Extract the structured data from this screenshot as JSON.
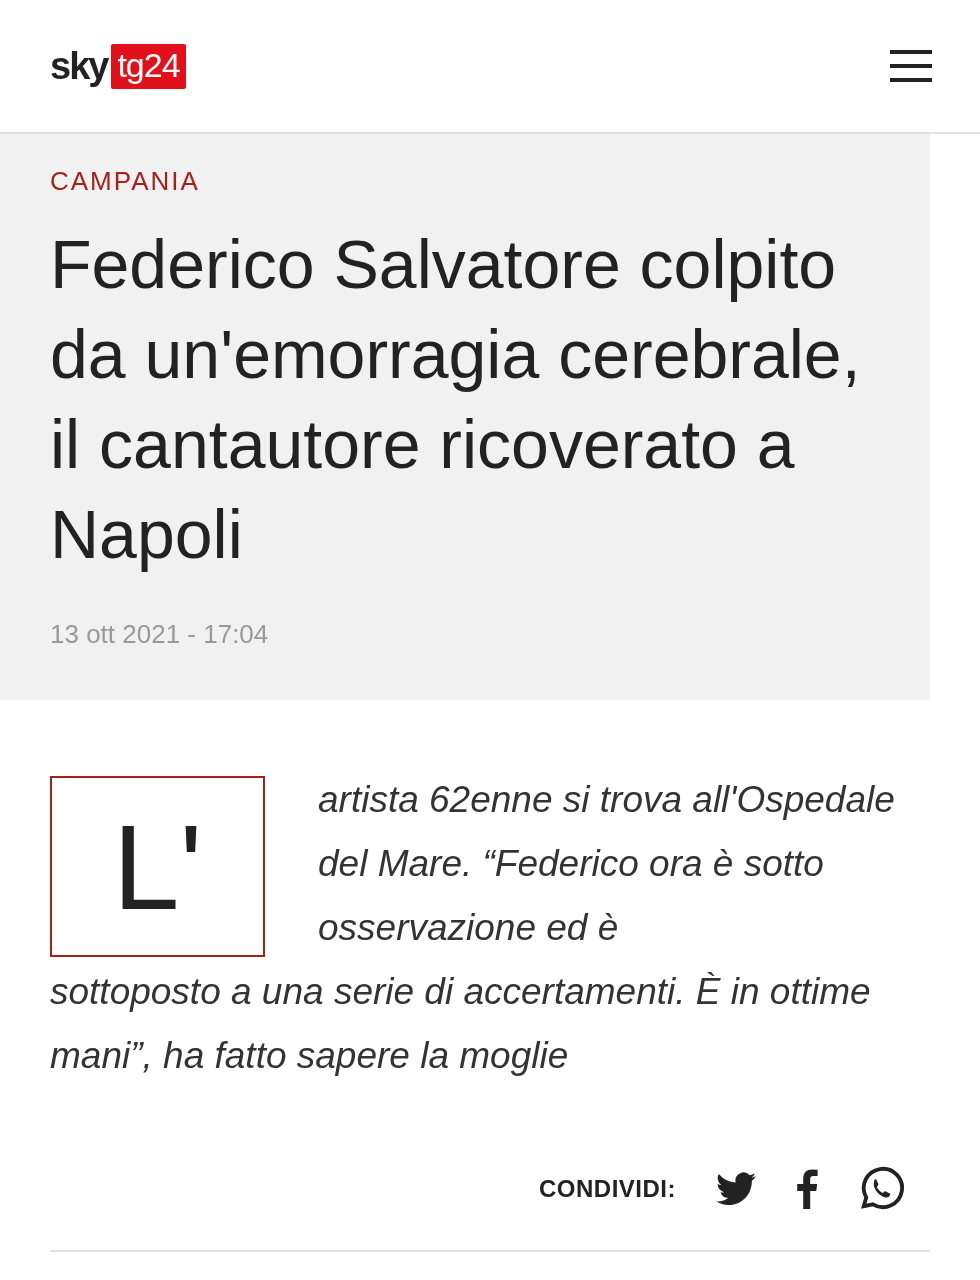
{
  "header": {
    "logo": {
      "brand": "sky",
      "badge": "tg24"
    }
  },
  "article": {
    "category": "CAMPANIA",
    "title": "Federico Salvatore colpito da un'emorragia cerebrale, il cantautore ricoverato a Napoli",
    "date": "13 ott 2021 - 17:04",
    "drop_cap": "L'",
    "body": [
      "artista 62enne si trova all'Ospedale del Mare. “Federico ora è sotto osservazione ed è",
      "sottoposto a una serie di accertamenti. È in ottime mani”, ha fatto sapere la moglie"
    ]
  },
  "share": {
    "label": "CONDIVIDI:"
  }
}
